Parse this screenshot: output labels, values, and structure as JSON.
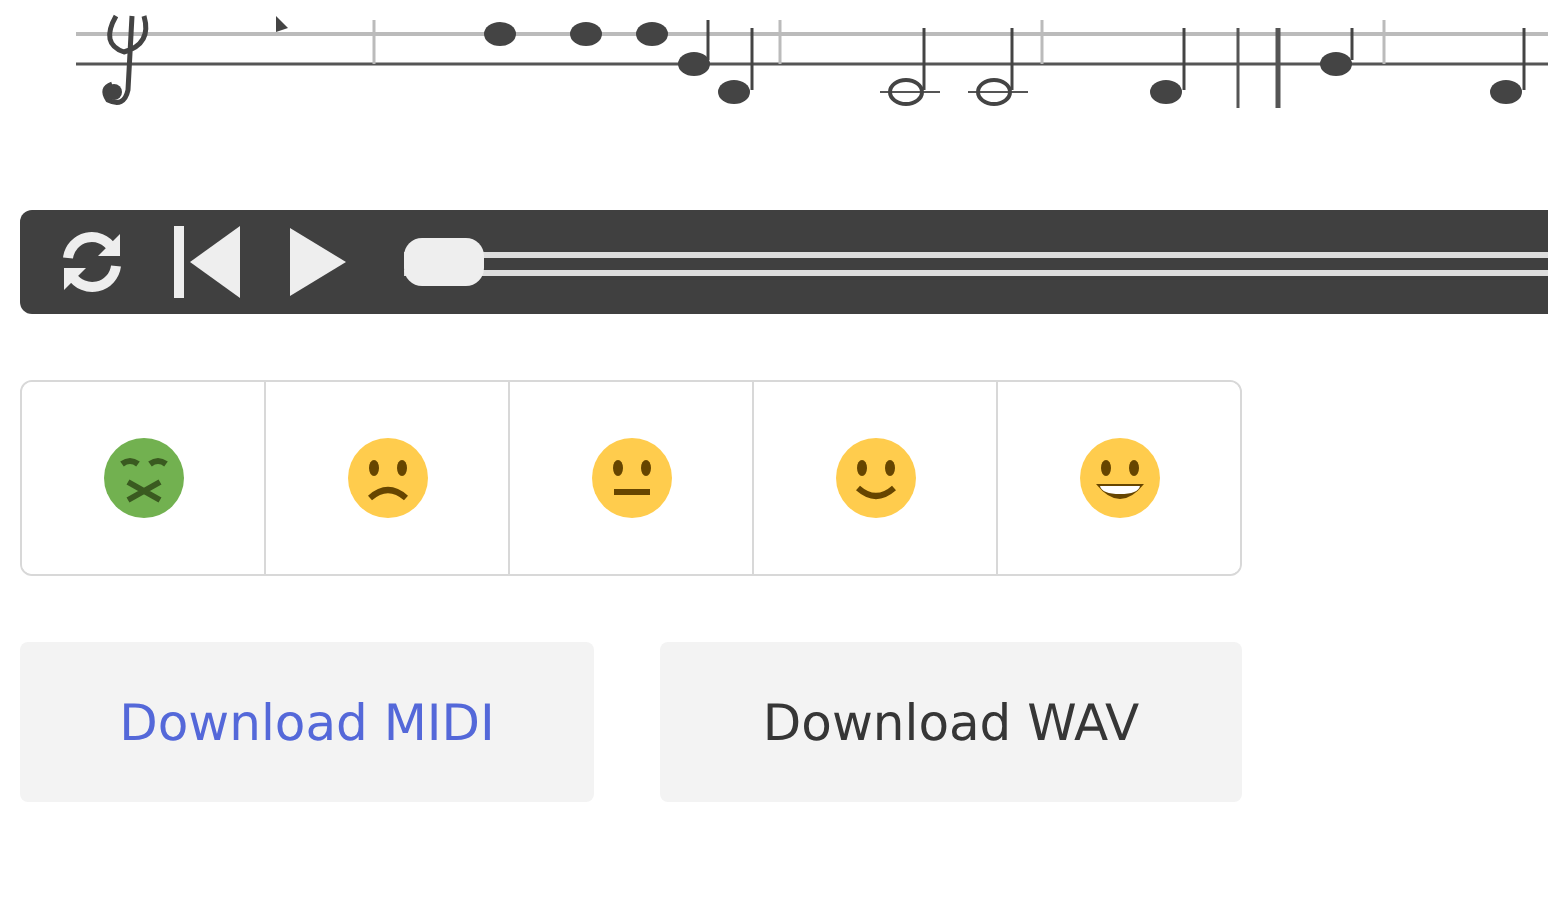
{
  "player": {
    "level": 0
  },
  "ratings": [
    {
      "kind": "sick"
    },
    {
      "kind": "sad"
    },
    {
      "kind": "neutral"
    },
    {
      "kind": "smile"
    },
    {
      "kind": "grin"
    }
  ],
  "downloads": [
    {
      "label": "Download MIDI",
      "active": true
    },
    {
      "label": "Download WAV",
      "active": false
    }
  ]
}
